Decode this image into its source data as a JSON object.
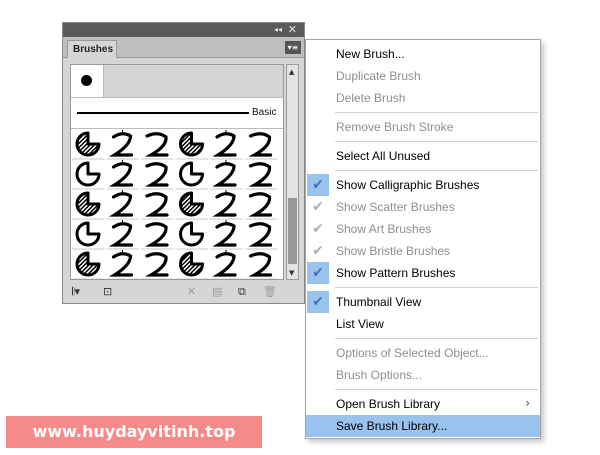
{
  "panel": {
    "collapse_glyph": "◂◂",
    "close_glyph": "✕",
    "tab_label": "Brushes",
    "menu_glyph": "▾≡",
    "basic_label": "Basic",
    "scroll_up_glyph": "▲",
    "scroll_down_glyph": "▼",
    "bottom_tools": [
      {
        "name": "brush-libraries-menu-icon",
        "glyph": "𝄃▾",
        "enabled": true
      },
      {
        "name": "libraries-panel-icon",
        "glyph": "⊡",
        "enabled": true
      },
      {
        "name": "remove-brush-stroke-icon",
        "glyph": "✕",
        "enabled": false
      },
      {
        "name": "options-of-selected-object-icon",
        "glyph": "▤",
        "enabled": false
      },
      {
        "name": "new-brush-icon",
        "glyph": "⧉",
        "enabled": true
      },
      {
        "name": "delete-brush-icon",
        "glyph": "🗑",
        "enabled": false
      }
    ]
  },
  "menu": {
    "items": [
      {
        "label": "New Brush...",
        "enabled": true,
        "checked": false
      },
      {
        "label": "Duplicate Brush",
        "enabled": false,
        "checked": false
      },
      {
        "label": "Delete Brush",
        "enabled": false,
        "checked": false
      },
      {
        "separator": true
      },
      {
        "label": "Remove Brush Stroke",
        "enabled": false,
        "checked": false
      },
      {
        "separator": true
      },
      {
        "label": "Select All Unused",
        "enabled": true,
        "checked": false
      },
      {
        "separator": true
      },
      {
        "label": "Show Calligraphic Brushes",
        "enabled": true,
        "checked": true
      },
      {
        "label": "Show Scatter Brushes",
        "enabled": false,
        "checked": true
      },
      {
        "label": "Show Art Brushes",
        "enabled": false,
        "checked": true
      },
      {
        "label": "Show Bristle Brushes",
        "enabled": false,
        "checked": true
      },
      {
        "label": "Show Pattern Brushes",
        "enabled": true,
        "checked": true
      },
      {
        "separator": true
      },
      {
        "label": "Thumbnail View",
        "enabled": true,
        "checked": true
      },
      {
        "label": "List View",
        "enabled": true,
        "checked": false
      },
      {
        "separator": true
      },
      {
        "label": "Options of Selected Object...",
        "enabled": false,
        "checked": false
      },
      {
        "label": "Brush Options...",
        "enabled": false,
        "checked": false
      },
      {
        "separator": true
      },
      {
        "label": "Open Brush Library",
        "enabled": true,
        "checked": false,
        "submenu": true
      },
      {
        "label": "Save Brush Library...",
        "enabled": true,
        "checked": false,
        "highlighted": true
      }
    ],
    "check_glyph": "✔",
    "submenu_glyph": "›"
  },
  "watermark": "www.huydayvitinh.top",
  "colors": {
    "menu_highlight": "#99c3ee",
    "check_blue": "#3b74b8",
    "watermark_bg": "#f48a8a"
  }
}
